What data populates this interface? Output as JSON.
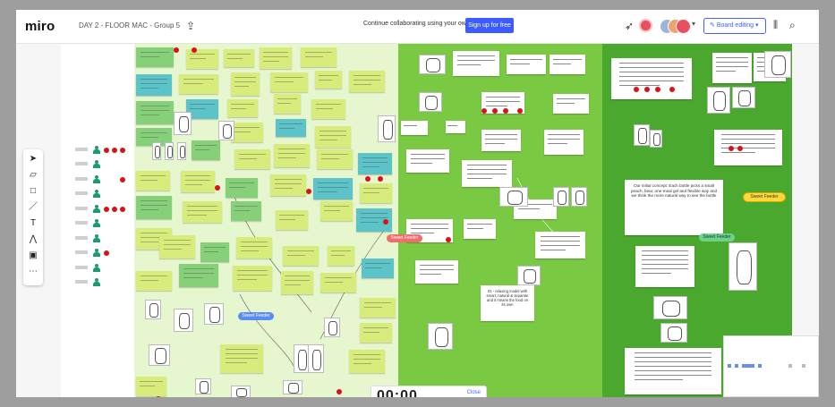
{
  "app": {
    "logo": "miro",
    "board_title": "DAY 2 - FLOOR MAC - Group 5"
  },
  "header": {
    "promo_text": "Continue collaborating using your own name",
    "signup_label": "Sign up for free",
    "share_label": "Board editing"
  },
  "icons": {
    "upload": "upload-icon",
    "cursor": "cursor-icon",
    "filter": "filter-icon",
    "search": "search-icon",
    "panel": "panel-icon"
  },
  "colors": {
    "zone_light": "#e6f6cf",
    "zone_mid": "#7ac943",
    "zone_dark": "#4aa82f",
    "sticky_yellow": "#d7ec7a",
    "sticky_green": "#87d07a",
    "sticky_teal": "#5cc4c8",
    "dot_red": "#d6121b",
    "accent_blue": "#3d5cff"
  },
  "tags": {
    "tag_red": "Sweet Feeder",
    "tag_blue": "Sweet Feeder",
    "tag_green": "Sweet Feeder",
    "tag_yellow": "Sweet Feeder"
  },
  "cards": {
    "zone2_text": "01 - relaxing model with smart, natural & separate and it means the food on its own",
    "zone3_text": "Our initial concept: Each bottle picks a small peach, bear, one-meal gel and flexible way and we think the more natural way to see the bottle"
  },
  "timer": {
    "value": "00:00",
    "close_label": "Close"
  }
}
